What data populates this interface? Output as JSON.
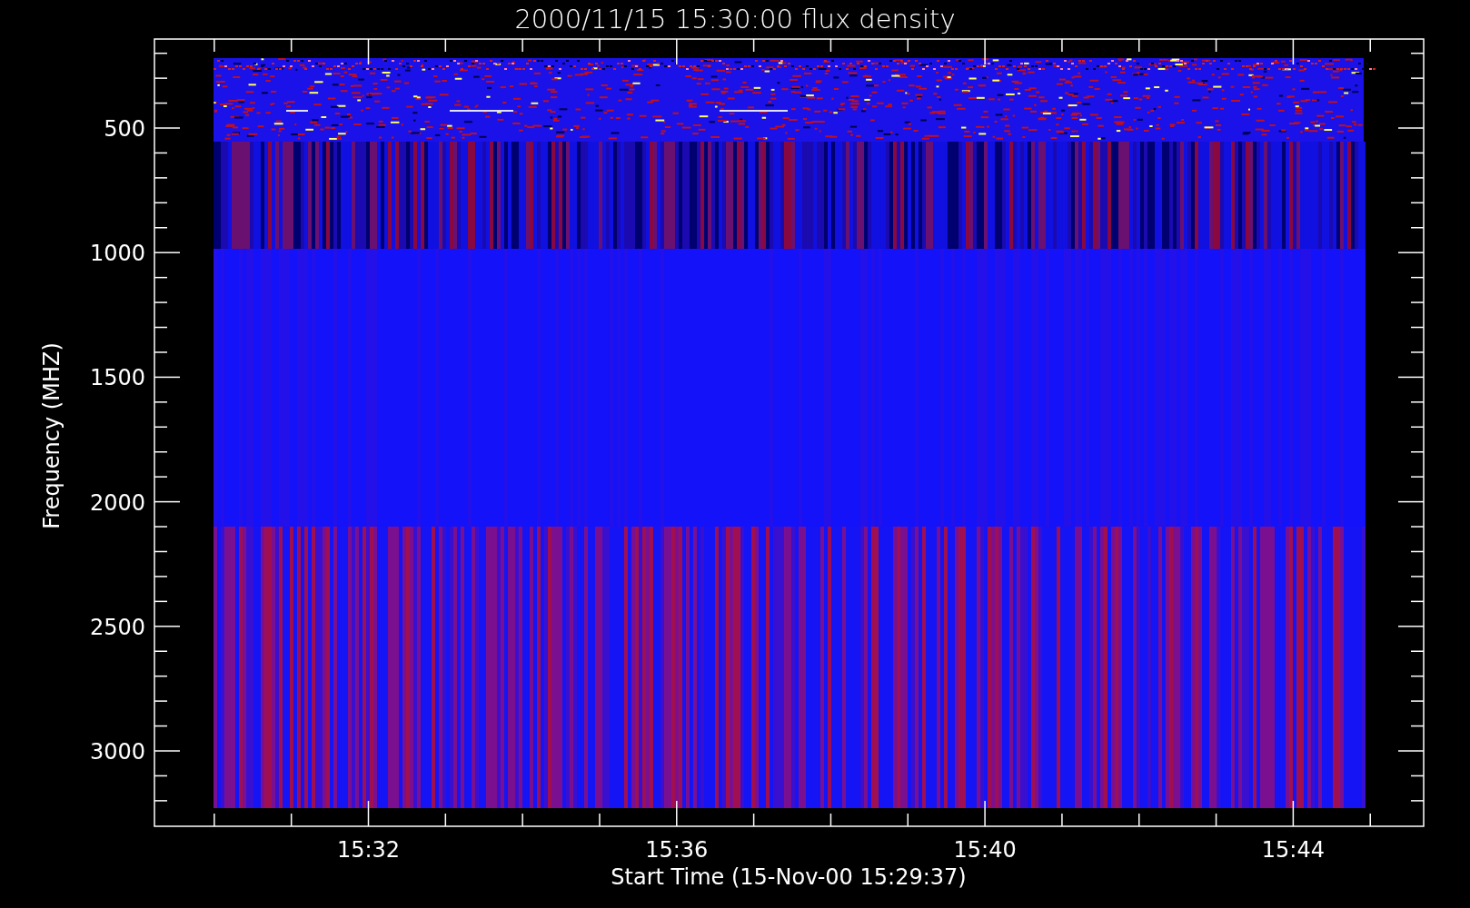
{
  "title": "2000/11/15 15:30:00 flux density",
  "y_axis": {
    "label": "Frequency (MHZ)",
    "ticks": [
      "500",
      "1000",
      "1500",
      "2000",
      "2500",
      "3000"
    ]
  },
  "x_axis": {
    "label": "Start Time (15-Nov-00 15:29:37)",
    "ticks": [
      "15:32",
      "15:36",
      "15:40",
      "15:44"
    ]
  }
}
